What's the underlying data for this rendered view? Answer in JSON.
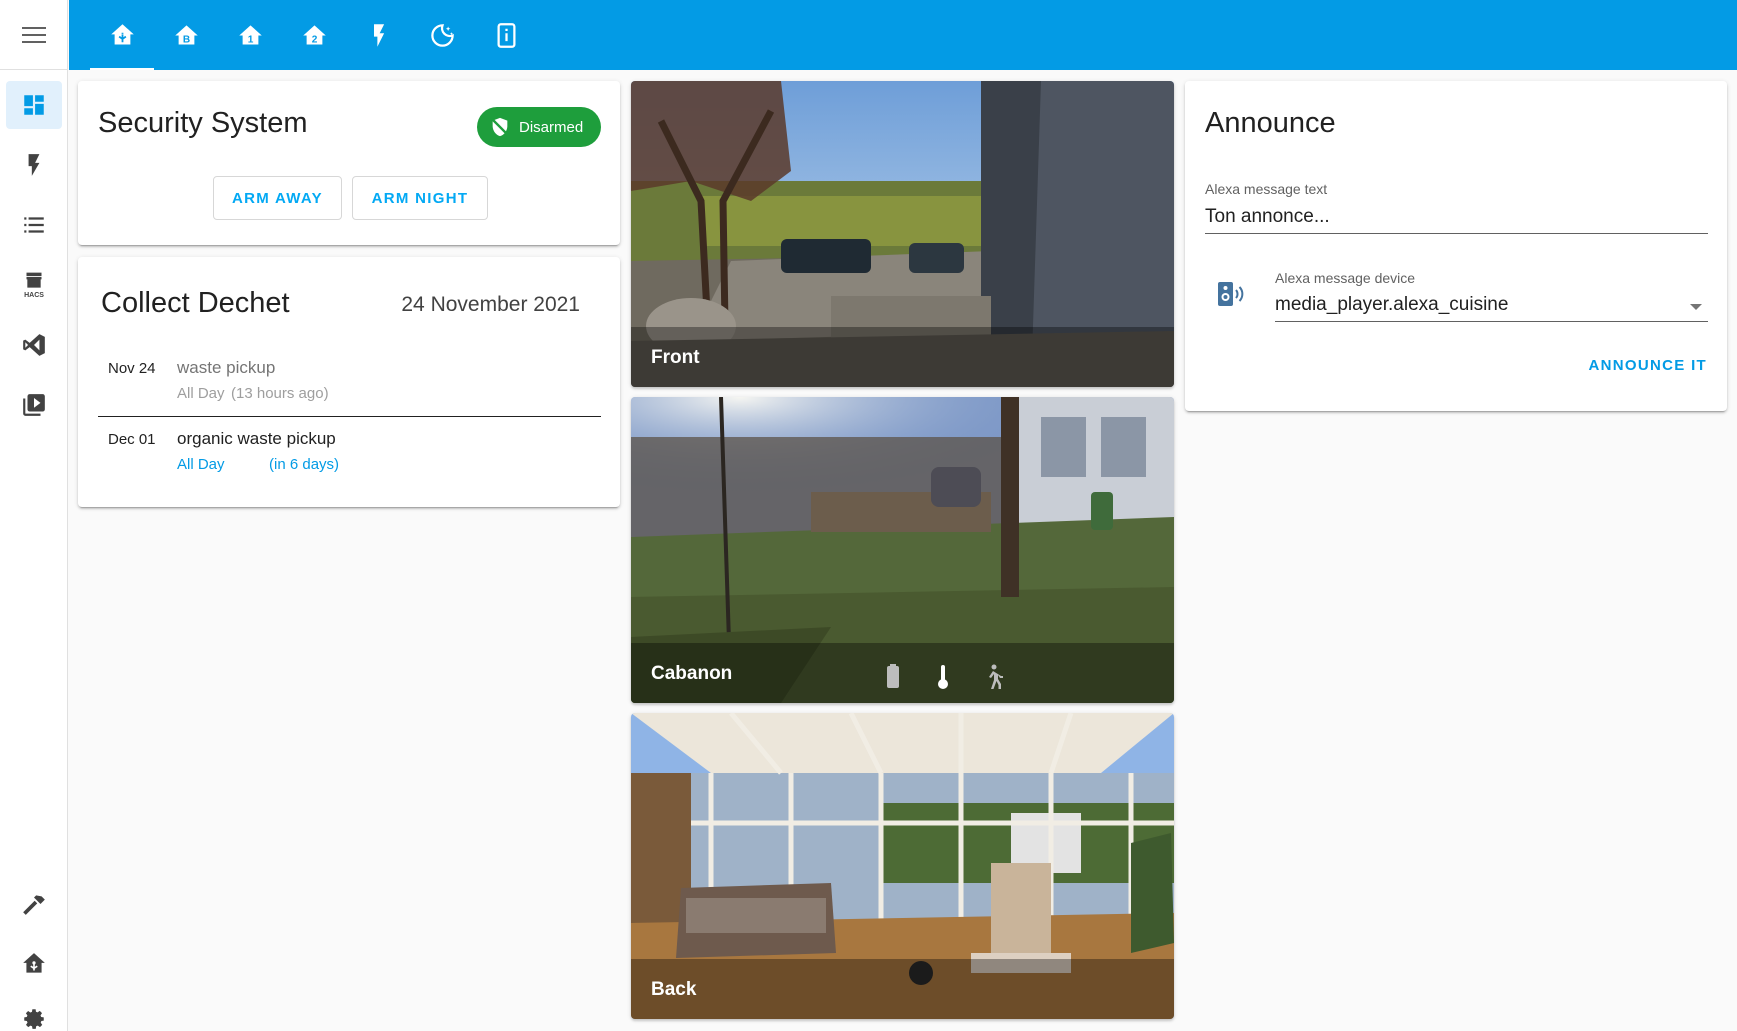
{
  "colors": {
    "topbar": "#039be5",
    "accent": "#03a9f4",
    "disarmed_badge": "#1e9e3c",
    "sidebar_active_bg": "#e1f0fc",
    "sidebar_icon": "#424242"
  },
  "sidebar": {
    "menu_icon": "hamburger-menu-icon",
    "items": [
      {
        "icon": "dashboard-icon",
        "active": true
      },
      {
        "icon": "lightning-icon",
        "active": false
      },
      {
        "icon": "list-icon",
        "active": false
      },
      {
        "icon": "hacs-store-icon",
        "active": false,
        "label": "HACS"
      },
      {
        "icon": "vscode-icon",
        "active": false
      },
      {
        "icon": "media-play-icon",
        "active": false
      }
    ],
    "bottom_items": [
      {
        "icon": "hammer-icon"
      },
      {
        "icon": "home-assistant-icon"
      },
      {
        "icon": "gear-icon"
      }
    ]
  },
  "topbar": {
    "tabs": [
      {
        "icon": "home-assistant-icon",
        "active": true
      },
      {
        "icon": "home-floor-b-icon",
        "active": false
      },
      {
        "icon": "home-floor-1-icon",
        "active": false
      },
      {
        "icon": "home-floor-2-icon",
        "active": false
      },
      {
        "icon": "lightning-icon",
        "active": false
      },
      {
        "icon": "moon-night-icon",
        "active": false
      },
      {
        "icon": "tablet-info-icon",
        "active": false
      }
    ]
  },
  "security": {
    "title": "Security System",
    "state": "Disarmed",
    "state_icon": "shield-off-icon",
    "buttons": {
      "arm_away": "ARM AWAY",
      "arm_night": "ARM NIGHT"
    }
  },
  "calendar": {
    "title": "Collect Dechet",
    "date": "24 November 2021",
    "events": [
      {
        "date": "Nov 24",
        "title": "waste pickup",
        "when": "All Day",
        "relative": "(13 hours ago)",
        "past": true
      },
      {
        "date": "Dec 01",
        "title": "organic waste pickup",
        "when": "All Day",
        "relative": "(in 6 days)",
        "past": false
      }
    ]
  },
  "cameras": [
    {
      "label": "Front",
      "icons": []
    },
    {
      "label": "Cabanon",
      "icons": [
        "battery-icon",
        "thermometer-icon",
        "walk-motion-icon"
      ]
    },
    {
      "label": "Back",
      "icons": []
    }
  ],
  "announce": {
    "title": "Announce",
    "text_label": "Alexa message text",
    "text_value": "Ton annonce...",
    "device_label": "Alexa message device",
    "device_value": "media_player.alexa_cuisine",
    "device_icon": "speaker-icon",
    "button": "ANNOUNCE IT"
  }
}
